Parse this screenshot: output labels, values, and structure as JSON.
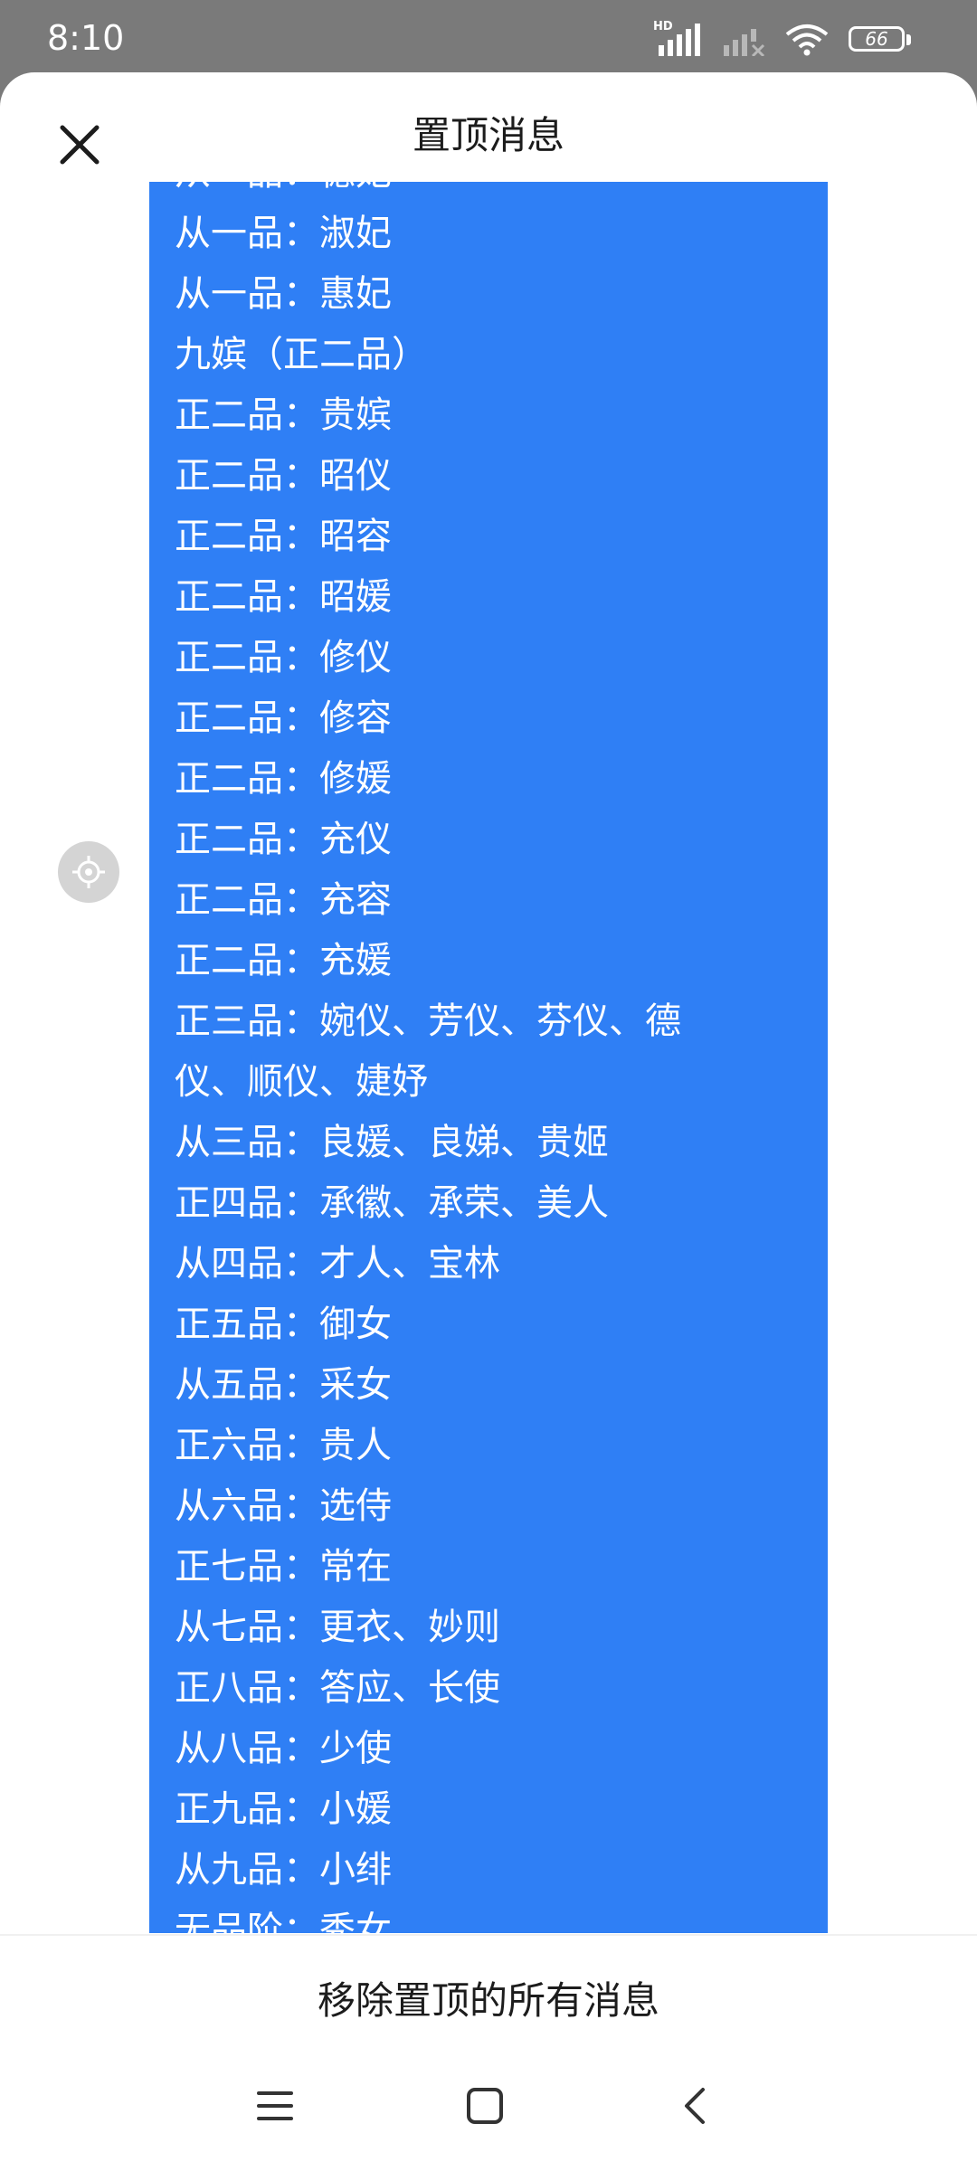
{
  "status_bar": {
    "time": "8:10",
    "network_label": "HD",
    "battery": "66",
    "icons": [
      "signal-hd-icon",
      "signal-no-service-icon",
      "wifi-icon",
      "battery-icon"
    ]
  },
  "header": {
    "title": "置顶消息",
    "close_icon": "close-icon"
  },
  "locate_icon": "crosshair-icon",
  "message": {
    "bubble_color": "#2f7ff5",
    "lines": [
      "从一品：德妃",
      "从一品：淑妃",
      "从一品：惠妃",
      "九嫔（正二品）",
      "正二品：贵嫔",
      "正二品：昭仪",
      "正二品：昭容",
      "正二品：昭媛",
      "正二品：修仪",
      "正二品：修容",
      "正二品：修媛",
      "正二品：充仪",
      "正二品：充容",
      "正二品：充媛",
      "正三品：婉仪、芳仪、芬仪、德",
      "仪、顺仪、婕妤",
      "从三品：良媛、良娣、贵姬",
      "正四品：承徽、承荣、美人",
      "从四品：才人、宝林",
      "正五品：御女",
      "从五品：采女",
      "正六品：贵人",
      "从六品：选侍",
      "正七品：常在",
      "从七品：更衣、妙则",
      "正八品：答应、长使",
      "从八品：少使",
      "正九品：小媛",
      "从九品：小绯",
      "无品阶：秀女"
    ]
  },
  "footer": {
    "unpin_all_label": "移除置顶的所有消息"
  },
  "nav_bar": {
    "icons": [
      "menu-icon",
      "home-icon",
      "back-icon"
    ]
  }
}
